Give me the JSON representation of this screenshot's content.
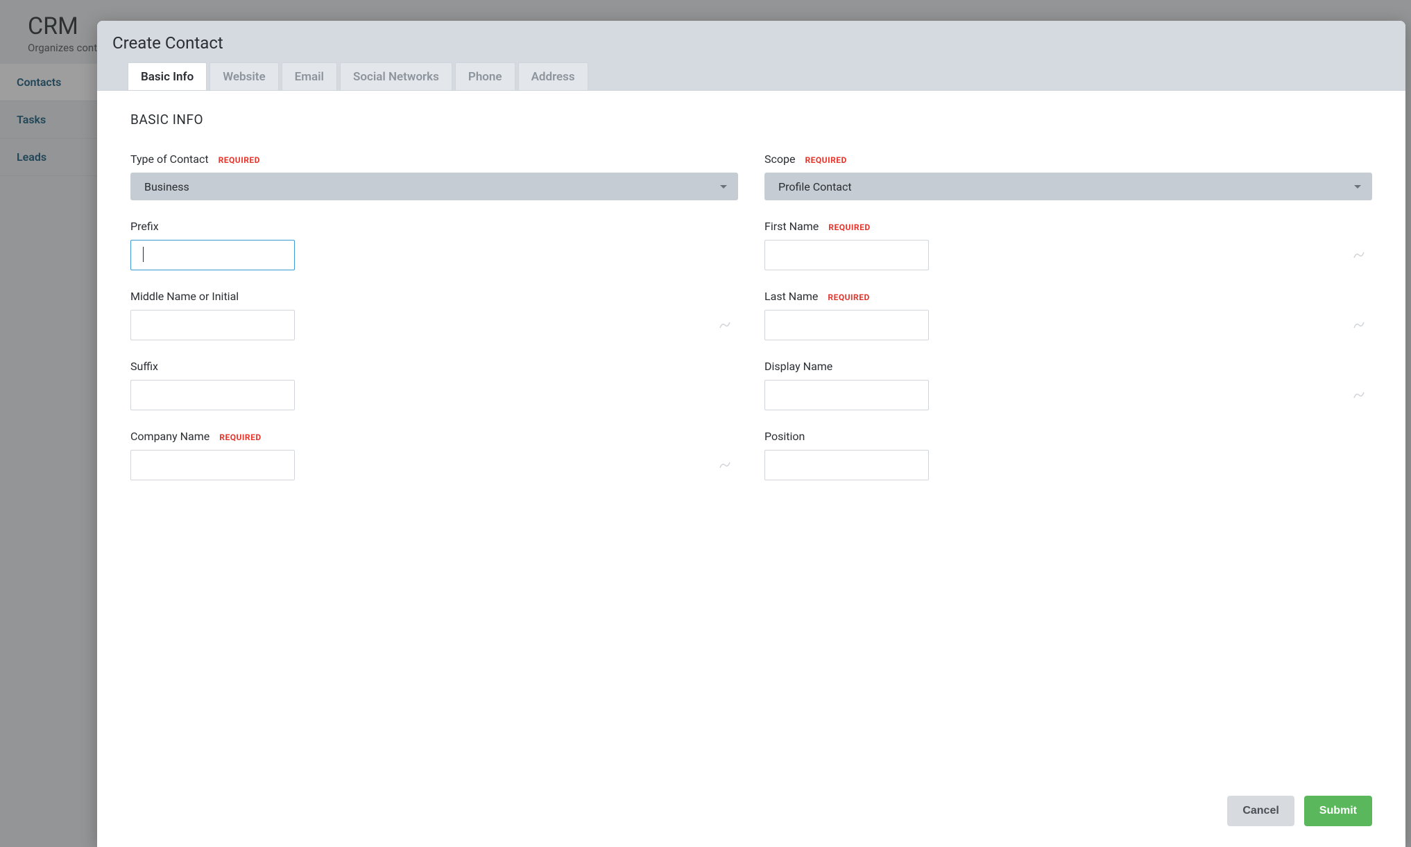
{
  "page": {
    "app_title": "CRM",
    "app_subtitle_fragment": "Organizes cont"
  },
  "sidebar": {
    "items": [
      {
        "label": "Contacts"
      },
      {
        "label": "Tasks"
      },
      {
        "label": "Leads"
      }
    ]
  },
  "modal": {
    "title": "Create Contact",
    "tabs": [
      {
        "label": "Basic Info",
        "active": true
      },
      {
        "label": "Website"
      },
      {
        "label": "Email"
      },
      {
        "label": "Social Networks"
      },
      {
        "label": "Phone"
      },
      {
        "label": "Address"
      }
    ],
    "section_title": "BASIC INFO",
    "required_badge": "REQUIRED",
    "fields": {
      "type_of_contact": {
        "label": "Type of Contact",
        "value": "Business",
        "required": true
      },
      "scope": {
        "label": "Scope",
        "value": "Profile Contact",
        "required": true
      },
      "prefix": {
        "label": "Prefix",
        "value": ""
      },
      "first_name": {
        "label": "First Name",
        "value": "",
        "required": true
      },
      "middle_name": {
        "label": "Middle Name or Initial",
        "value": ""
      },
      "last_name": {
        "label": "Last Name",
        "value": "",
        "required": true
      },
      "suffix": {
        "label": "Suffix",
        "value": ""
      },
      "display_name": {
        "label": "Display Name",
        "value": ""
      },
      "company_name": {
        "label": "Company Name",
        "value": "",
        "required": true
      },
      "position": {
        "label": "Position",
        "value": ""
      }
    },
    "buttons": {
      "cancel": "Cancel",
      "submit": "Submit"
    }
  }
}
